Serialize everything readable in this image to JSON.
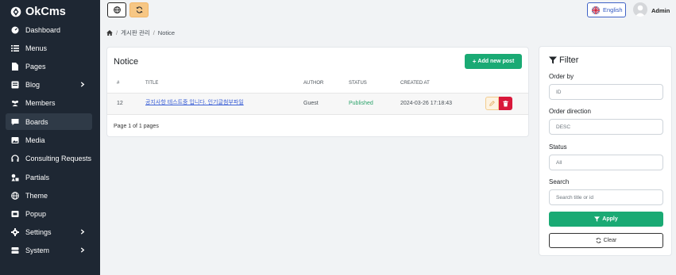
{
  "app": {
    "name": "OkCms"
  },
  "sidebar": {
    "items": [
      {
        "label": "Dashboard",
        "icon": "dashboard-icon",
        "has_submenu": false,
        "active": false
      },
      {
        "label": "Menus",
        "icon": "list-icon",
        "has_submenu": false,
        "active": false
      },
      {
        "label": "Pages",
        "icon": "file-icon",
        "has_submenu": false,
        "active": false
      },
      {
        "label": "Blog",
        "icon": "blog-icon",
        "has_submenu": true,
        "active": false
      },
      {
        "label": "Members",
        "icon": "users-icon",
        "has_submenu": false,
        "active": false
      },
      {
        "label": "Boards",
        "icon": "comment-icon",
        "has_submenu": false,
        "active": true
      },
      {
        "label": "Media",
        "icon": "image-icon",
        "has_submenu": false,
        "active": false
      },
      {
        "label": "Consulting Requests",
        "icon": "headset-icon",
        "has_submenu": false,
        "active": false
      },
      {
        "label": "Partials",
        "icon": "shapes-icon",
        "has_submenu": false,
        "active": false
      },
      {
        "label": "Theme",
        "icon": "globe-icon",
        "has_submenu": false,
        "active": false
      },
      {
        "label": "Popup",
        "icon": "popup-icon",
        "has_submenu": false,
        "active": false
      },
      {
        "label": "Settings",
        "icon": "gear-icon",
        "has_submenu": true,
        "active": false
      },
      {
        "label": "System",
        "icon": "server-icon",
        "has_submenu": true,
        "active": false
      }
    ]
  },
  "topbar": {
    "language_label": "English",
    "user_name": "Admin"
  },
  "breadcrumb": {
    "items": [
      "게시판 관리",
      "Notice"
    ]
  },
  "board": {
    "title": "Notice",
    "add_button_label": "Add new post",
    "columns": [
      "#",
      "TITLE",
      "AUTHOR",
      "STATUS",
      "CREATED AT"
    ],
    "rows": [
      {
        "id": "12",
        "title": "공지사항 테스트중 입니다. 인기글첨부파일",
        "author": "Guest",
        "status": "Published",
        "created_at": "2024-03-26 17:18:43"
      }
    ],
    "pagination": "Page 1 of 1 pages"
  },
  "filter": {
    "title": "Filter",
    "order_by_label": "Order by",
    "order_by_value": "ID",
    "order_direction_label": "Order direction",
    "order_direction_value": "DESC",
    "status_label": "Status",
    "status_value": "All",
    "search_label": "Search",
    "search_placeholder": "Search title or id",
    "apply_label": "Apply",
    "clear_label": "Clear"
  },
  "colors": {
    "sidebar_bg": "#1e2733",
    "primary_green": "#1aaa74",
    "danger_red": "#d9183b",
    "published_green": "#2ca36b",
    "link_blue": "#3a5fd6"
  }
}
